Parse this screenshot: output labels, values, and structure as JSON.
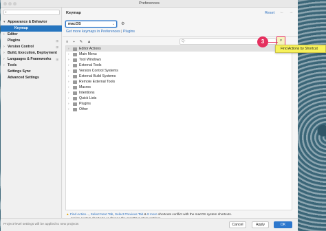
{
  "window": {
    "title": "Preferences"
  },
  "sidebar": {
    "search_placeholder": "",
    "items": [
      {
        "label": "Appearance & Behavior",
        "arrow": "▾",
        "config": ""
      },
      {
        "label": "Keymap",
        "arrow": "",
        "config": ""
      },
      {
        "label": "Editor",
        "arrow": "›",
        "config": ""
      },
      {
        "label": "Plugins",
        "arrow": "",
        "config": "⊞"
      },
      {
        "label": "Version Control",
        "arrow": "›",
        "config": "⊞"
      },
      {
        "label": "Build, Execution, Deployment",
        "arrow": "›",
        "config": ""
      },
      {
        "label": "Languages & Frameworks",
        "arrow": "›",
        "config": "⊞"
      },
      {
        "label": "Tools",
        "arrow": "›",
        "config": ""
      },
      {
        "label": "Settings Sync",
        "arrow": "",
        "config": ""
      },
      {
        "label": "Advanced Settings",
        "arrow": "",
        "config": ""
      }
    ]
  },
  "main": {
    "heading": "Keymap",
    "reset_label": "Reset",
    "nav_arrows": "← →",
    "keymap_select": "macOS",
    "link_plugins_keymaps": "Get more keymaps in Preferences",
    "link_separator": "|",
    "link_plugins": "Plugins",
    "toolbar_icons": [
      "≡",
      "÷",
      "✎",
      "▲"
    ],
    "filter_placeholder": "Q-",
    "shortcut_button_glyph": "⌕",
    "tree": [
      "Editor Actions",
      "Main Menu",
      "Tool Windows",
      "External Tools",
      "Version Control Systems",
      "External Build Systems",
      "Remote External Tools",
      "Macros",
      "Intentions",
      "Quick Lists",
      "Plugins",
      "Other"
    ],
    "warning": {
      "link1": "Find Action...",
      "link2": "Select Next Tab",
      "link3": "Select Previous Tab",
      "sep": ", ",
      "and": " & ",
      "more_link": "8 more",
      "text1": " shortcuts conflict with the macOS system shortcuts.",
      "text2": "Assign custom shortcuts or change the macOS system settings."
    }
  },
  "footer": {
    "note": "Project-level settings will be applied to new projects",
    "cancel_label": "Cancel",
    "apply_label": "Apply",
    "ok_label": "OK"
  },
  "overlay": {
    "step_number": "3",
    "tooltip_text": "Find Actions by Shortcut",
    "accent_color": "#e5305f",
    "highlight_color": "#f7f25b"
  }
}
